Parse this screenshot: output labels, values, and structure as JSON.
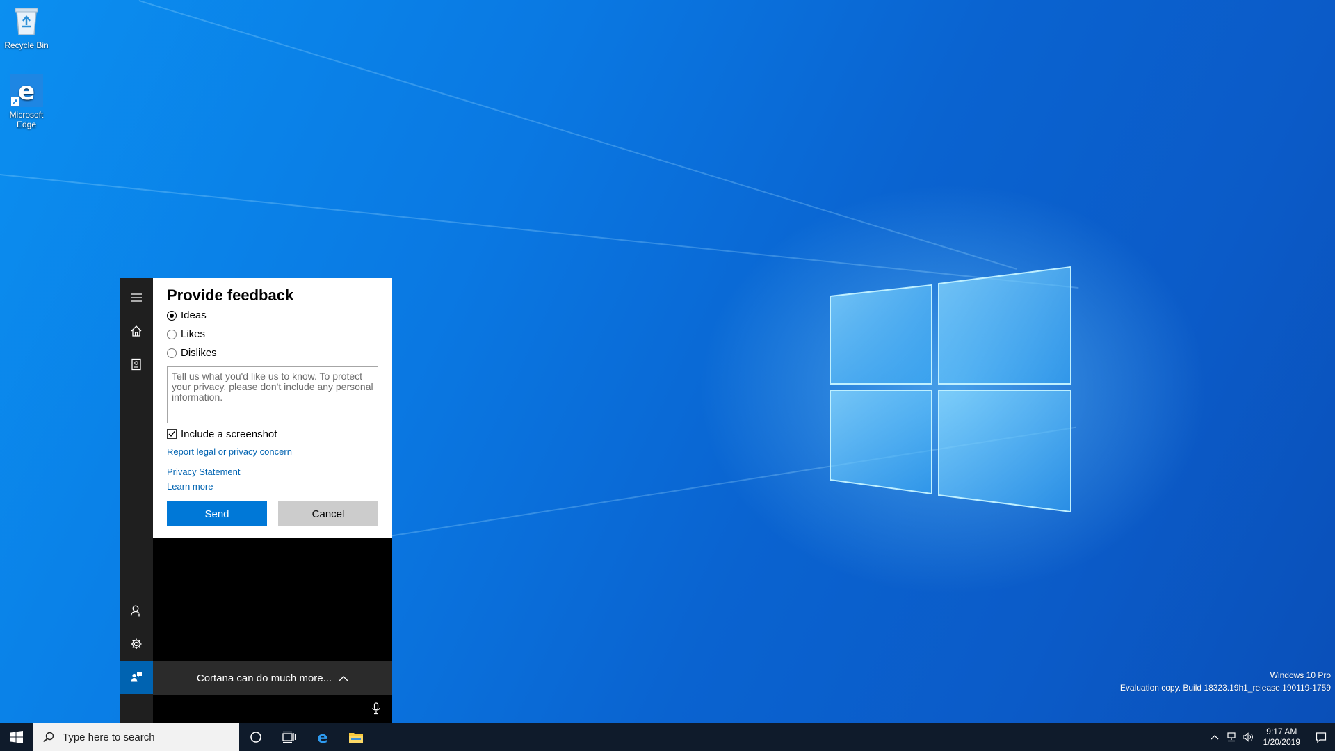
{
  "desktop": {
    "icons": [
      {
        "label": "Recycle Bin",
        "icon": "recycle-bin-icon"
      },
      {
        "label": "Microsoft Edge",
        "icon": "edge-icon"
      }
    ],
    "watermark": {
      "line1": "Windows 10 Pro",
      "line2": "Evaluation copy. Build 18323.19h1_release.190119-1759"
    }
  },
  "cortana": {
    "rail": {
      "menu_icon": "hamburger-icon",
      "home_icon": "home-icon",
      "notebook_icon": "notebook-icon",
      "account_icon": "person-icon",
      "settings_icon": "gear-icon",
      "feedback_icon": "feedback-icon"
    },
    "feedback": {
      "title": "Provide feedback",
      "options": [
        {
          "label": "Ideas",
          "checked": true
        },
        {
          "label": "Likes",
          "checked": false
        },
        {
          "label": "Dislikes",
          "checked": false
        }
      ],
      "textarea_placeholder": "Tell us what you'd like us to know. To protect your privacy, please don't include any personal information.",
      "textarea_value": "",
      "include_screenshot_label": "Include a screenshot",
      "include_screenshot_checked": true,
      "links": {
        "report": "Report legal or privacy concern",
        "privacy": "Privacy Statement",
        "learn_more": "Learn more"
      },
      "send_label": "Send",
      "cancel_label": "Cancel"
    },
    "more_label": "Cortana can do much more...",
    "mic_icon": "microphone-icon"
  },
  "taskbar": {
    "search_placeholder": "Type here to search",
    "clock": {
      "time": "9:17 AM",
      "date": "1/20/2019"
    }
  },
  "colors": {
    "accent": "#0078d7",
    "link": "#0063b1",
    "taskbar": "#0f1b2b",
    "rail": "#1f1f1f"
  }
}
